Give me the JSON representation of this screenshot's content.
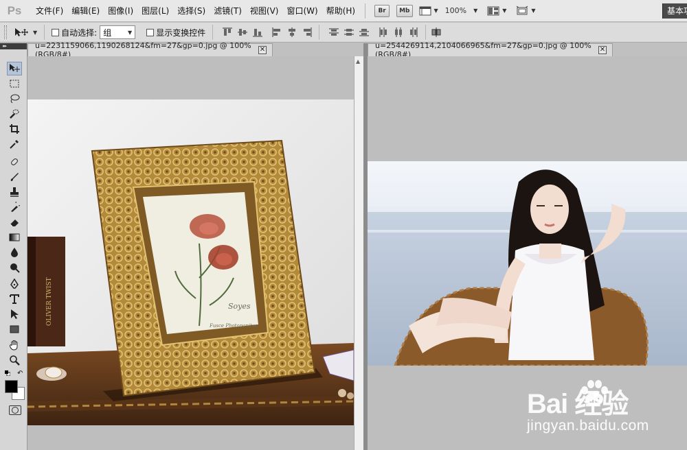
{
  "app": {
    "logo": "Ps"
  },
  "menu": [
    "文件(F)",
    "编辑(E)",
    "图像(I)",
    "图层(L)",
    "选择(S)",
    "滤镜(T)",
    "视图(V)",
    "窗口(W)",
    "帮助(H)"
  ],
  "menubar_tools": {
    "bridge": "Br",
    "minibridge": "Mb",
    "zoom": "100%",
    "workspace": "基本功能"
  },
  "options": {
    "auto_select_label": "自动选择:",
    "auto_select_value": "组",
    "show_transform_label": "显示变换控件"
  },
  "tools_panel": {
    "header": "▸▸"
  },
  "documents": [
    {
      "tab_title": "u=2231159066,1190268124&fm=27&gp=0.jpg @ 100%(RGB/8#)",
      "close": "✕"
    },
    {
      "tab_title": "u=2544269114,2104066965&fm=27&gp=0.jpg @ 100%(RGB/8#)",
      "close": "✕"
    }
  ],
  "photo1": {
    "script_text": "Soyes",
    "caption_text": "Fusce Photopanitus",
    "book_text": "OLIVER TWIST"
  },
  "watermark": {
    "brand": "Bai  经验",
    "url": "jingyan.baidu.com"
  },
  "colors": {
    "foreground": "#000000",
    "background": "#ffffff",
    "active_tool": "#b5c4d6"
  }
}
